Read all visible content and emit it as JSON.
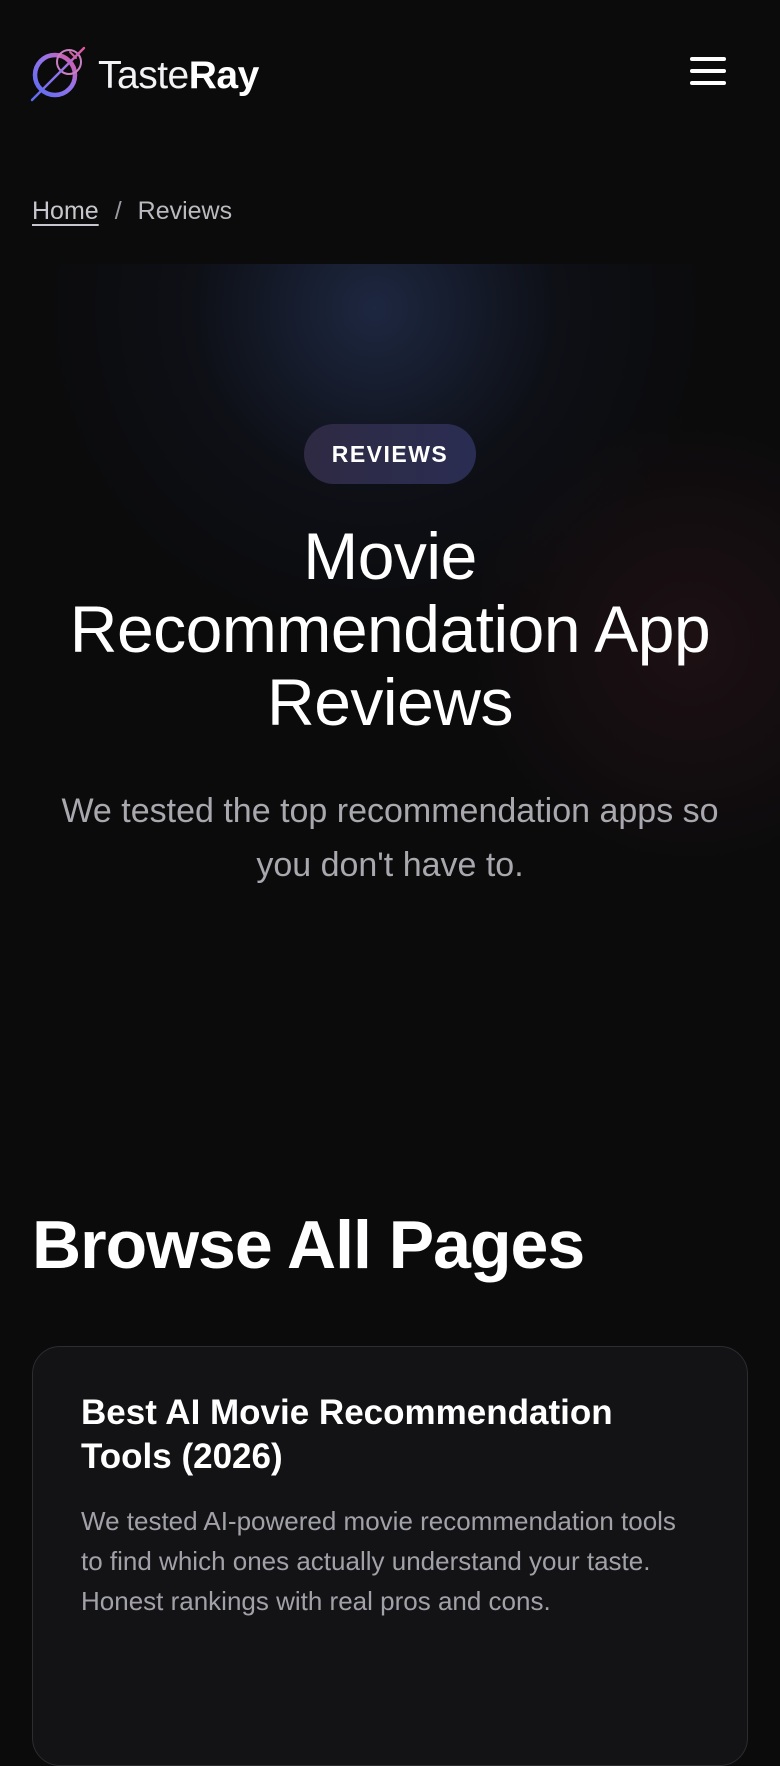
{
  "header": {
    "brand_regular": "Taste",
    "brand_bold": "Ray",
    "logo_icon": "compass-ring-logo-icon",
    "menu_icon": "hamburger-menu-icon"
  },
  "breadcrumb": {
    "home": "Home",
    "separator": "/",
    "current": "Reviews"
  },
  "hero": {
    "badge": "REVIEWS",
    "title": "Movie Recommendation App Reviews",
    "subtitle": "We tested the top recommendation apps so you don't have to."
  },
  "browse": {
    "title": "Browse All Pages",
    "cards": [
      {
        "title": "Best AI Movie Recommendation Tools (2026)",
        "description": "We tested AI-powered movie recommendation tools to find which ones actually understand your taste. Honest rankings with real pros and cons."
      }
    ]
  },
  "colors": {
    "background": "#0b0b0c",
    "badge_gradient_start": "#2e2a43",
    "badge_gradient_end": "#2a2d52",
    "logo_blue": "#6f6ff0",
    "logo_pink": "#d9589a",
    "muted_text": "#a8a8ae",
    "card_background": "#131315",
    "card_border": "#2c2c31"
  }
}
